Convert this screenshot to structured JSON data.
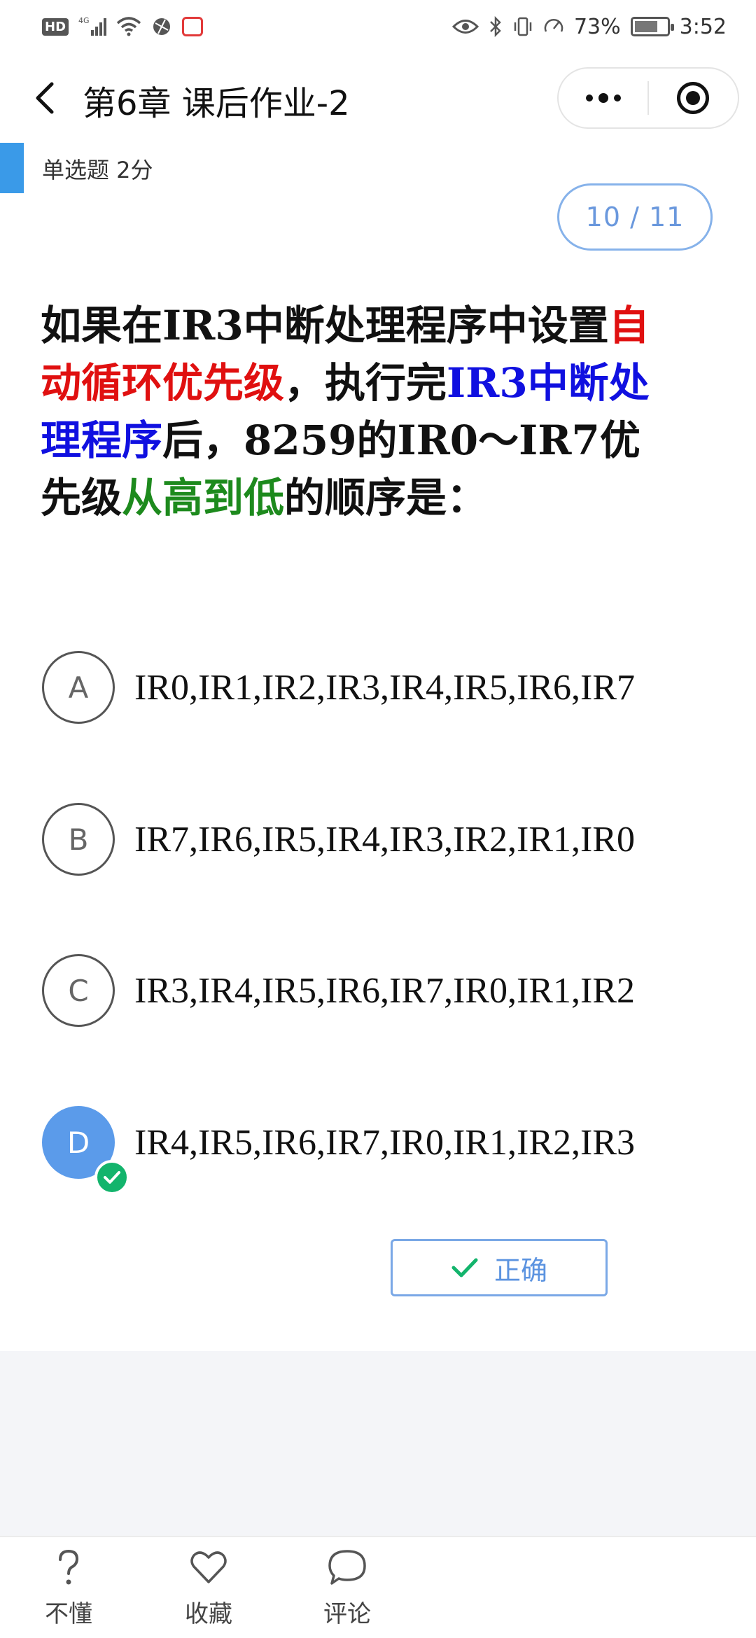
{
  "status_bar": {
    "network": "4G",
    "battery_percent": "73%",
    "battery_level": 0.73,
    "time": "3:52"
  },
  "nav": {
    "title": "第6章 课后作业-2"
  },
  "question": {
    "type_label": "单选题 2分",
    "progress": "10 / 11",
    "text_parts": [
      {
        "text": "如果在IR3中断处理程序中设置",
        "color": "black"
      },
      {
        "text": "自动循环优先级",
        "color": "red"
      },
      {
        "text": "，执行完",
        "color": "black"
      },
      {
        "text": "IR3中断处理程序",
        "color": "blue"
      },
      {
        "text": "后，8259的IR0～IR7优先级",
        "color": "black"
      },
      {
        "text": "从高到低",
        "color": "green"
      },
      {
        "text": "的顺序是：",
        "color": "black"
      }
    ]
  },
  "options": [
    {
      "letter": "A",
      "text": "IR0,IR1,IR2,IR3,IR4,IR5,IR6,IR7",
      "selected": false
    },
    {
      "letter": "B",
      "text": "IR7,IR6,IR5,IR4,IR3,IR2,IR1,IR0",
      "selected": false
    },
    {
      "letter": "C",
      "text": "IR3,IR4,IR5,IR6,IR7,IR0,IR1,IR2",
      "selected": false
    },
    {
      "letter": "D",
      "text": "IR4,IR5,IR6,IR7,IR0,IR1,IR2,IR3",
      "selected": true
    }
  ],
  "result": {
    "label": "正确",
    "icon": "check-icon"
  },
  "bottom_bar": {
    "tabs": [
      {
        "label": "不懂",
        "icon": "question-icon"
      },
      {
        "label": "收藏",
        "icon": "heart-icon"
      },
      {
        "label": "评论",
        "icon": "comment-icon"
      }
    ]
  },
  "colors": {
    "accent": "#5b9bea",
    "correct": "#13b46c",
    "highlight_red": "#e01010",
    "highlight_blue": "#1010e0",
    "highlight_green": "#1d8a1d"
  }
}
